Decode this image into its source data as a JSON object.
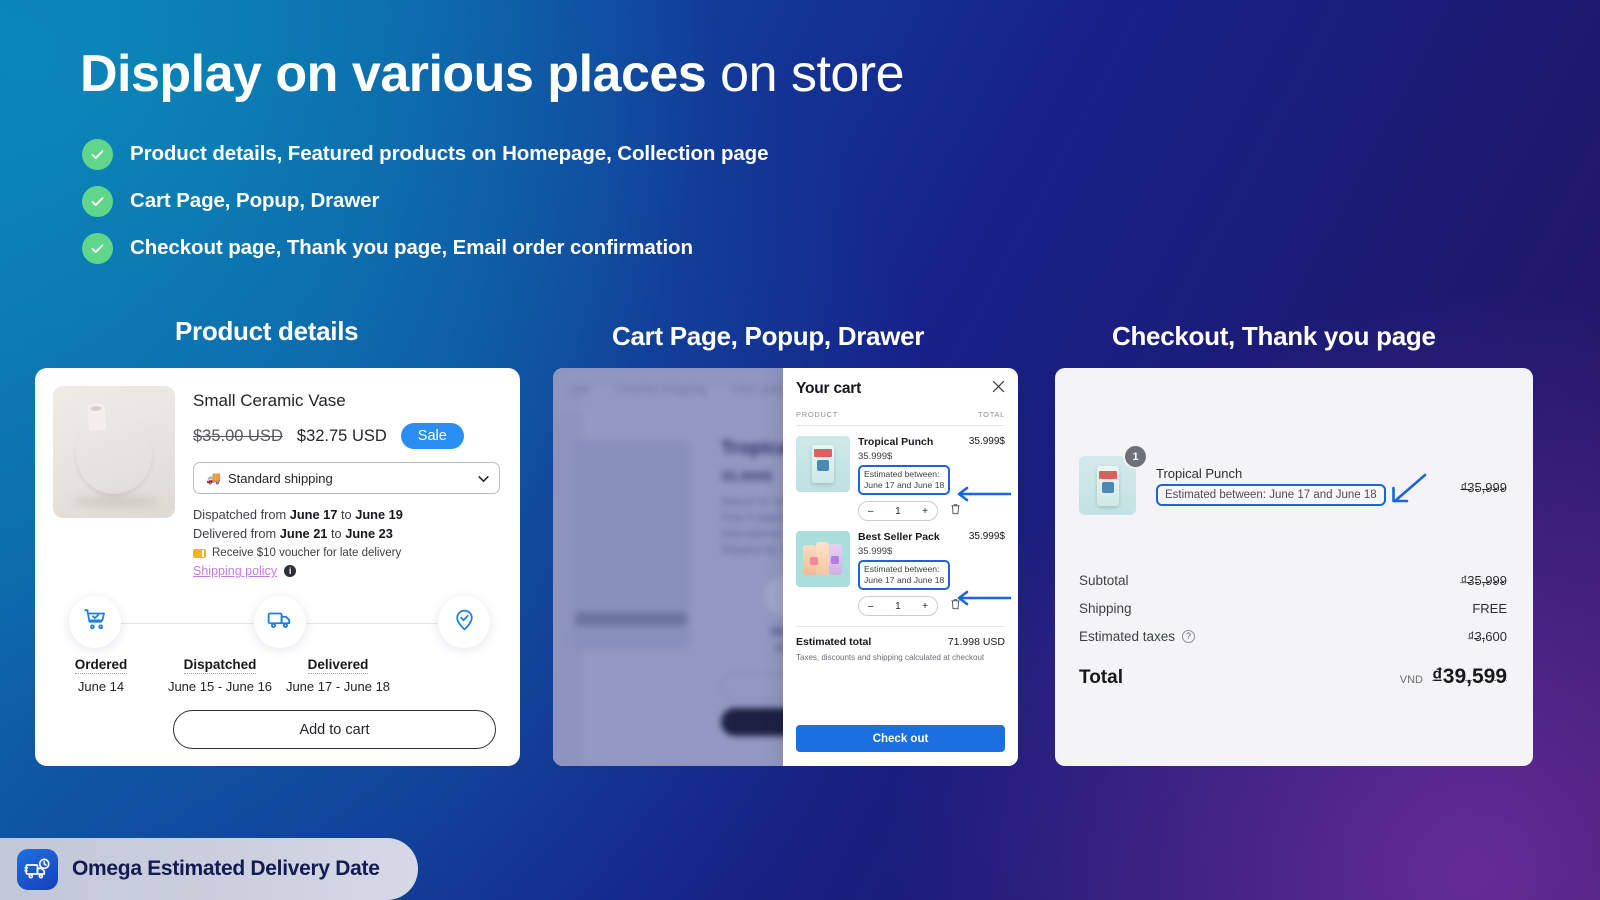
{
  "headline": {
    "bold": "Display on various places",
    "rest": " on store"
  },
  "bullets": [
    {
      "label": "Product details, Featured products on Homepage, Collection page",
      "icon": "check-circle-icon"
    },
    {
      "label": "Cart Page, Popup, Drawer",
      "icon": "check-circle-icon"
    },
    {
      "label": "Checkout page, Thank you page, Email order confirmation",
      "icon": "check-circle-icon"
    }
  ],
  "columns": {
    "product": "Product details",
    "cart": "Cart Page, Popup, Drawer",
    "checkout": "Checkout, Thank you page"
  },
  "product_card": {
    "name": "Small Ceramic Vase",
    "price_old": "$35.00 USD",
    "price_new": "$32.75 USD",
    "sale_badge": "Sale",
    "shipping_select": "Standard shipping",
    "shipping_icon": "truck-icon",
    "dispatched_prefix": "Dispatched from ",
    "dispatched_from": "June 17",
    "dispatched_mid": " to ",
    "dispatched_to": "June 19",
    "delivered_prefix": "Delivered from ",
    "delivered_from": "June 21",
    "delivered_mid": " to ",
    "delivered_to": "June 23",
    "voucher": "Receive $10 voucher for late delivery",
    "shipping_policy": "Shipping policy",
    "timeline": [
      {
        "name": "Ordered",
        "date": "June 14",
        "icon": "cart-check-icon"
      },
      {
        "name": "Dispatched",
        "date": "June 15 - June 16",
        "icon": "truck-icon"
      },
      {
        "name": "Delivered",
        "date": "June 17 - June 18",
        "icon": "pin-check-icon"
      }
    ],
    "add_to_cart": "Add to cart"
  },
  "cart_background": {
    "nav": [
      "...ate",
      "Country shipping",
      "User guide",
      "Changel..."
    ],
    "title": "Tropical Punch",
    "price": "35.999$",
    "line1": "Deliver to: Vietnam",
    "line2": "Only  4 day(s) 10 : 2 : 59",
    "line3": "International delivery from ...",
    "line4": "Shipped by: Omega US",
    "step1": "Ordered",
    "step1_date": "June 14",
    "step2": "Dis...",
    "btn1": "Add ...",
    "btn2": "Buy ..."
  },
  "cart_drawer": {
    "title": "Your cart",
    "close_icon": "close-icon",
    "col_product": "PRODUCT",
    "col_total": "TOTAL",
    "items": [
      {
        "name": "Tropical Punch",
        "unit_price": "35.999$",
        "estimated_l1": "Estimated between:",
        "estimated_l2": "June 17 and June 18",
        "qty": "1",
        "minus": "–",
        "plus": "+",
        "line_total": "35.999$",
        "remove_icon": "trash-icon"
      },
      {
        "name": "Best Seller Pack",
        "unit_price": "35.999$",
        "estimated_l1": "Estimated between:",
        "estimated_l2": "June 17 and June 18",
        "qty": "1",
        "minus": "–",
        "plus": "+",
        "line_total": "35.999$",
        "remove_icon": "trash-icon"
      }
    ],
    "estimated_total_label": "Estimated total",
    "estimated_total_value": "71.998 USD",
    "note": "Taxes, discounts and shipping calculated at checkout",
    "checkout_button": "Check out"
  },
  "checkout_card": {
    "item_name": "Tropical Punch",
    "item_qty_badge": "1",
    "item_estimated": "Estimated between: June 17 and June 18",
    "item_price": "₫35,999",
    "lines": [
      {
        "label": "Subtotal",
        "value": "₫35,999",
        "info": false
      },
      {
        "label": "Shipping",
        "value": "FREE",
        "info": false
      },
      {
        "label": "Estimated taxes",
        "value": "₫3,600",
        "info": true
      }
    ],
    "total_label": "Total",
    "total_currency": "VND",
    "total_value": "₫39,599"
  },
  "brand": {
    "name": "Omega Estimated Delivery Date",
    "logo_icon": "delivery-truck-clock-icon"
  },
  "colors": {
    "accent_blue": "#1b63e0",
    "sale_blue": "#2b8ef2",
    "check_green": "#5fd68a",
    "brand_navy": "#141a52"
  }
}
